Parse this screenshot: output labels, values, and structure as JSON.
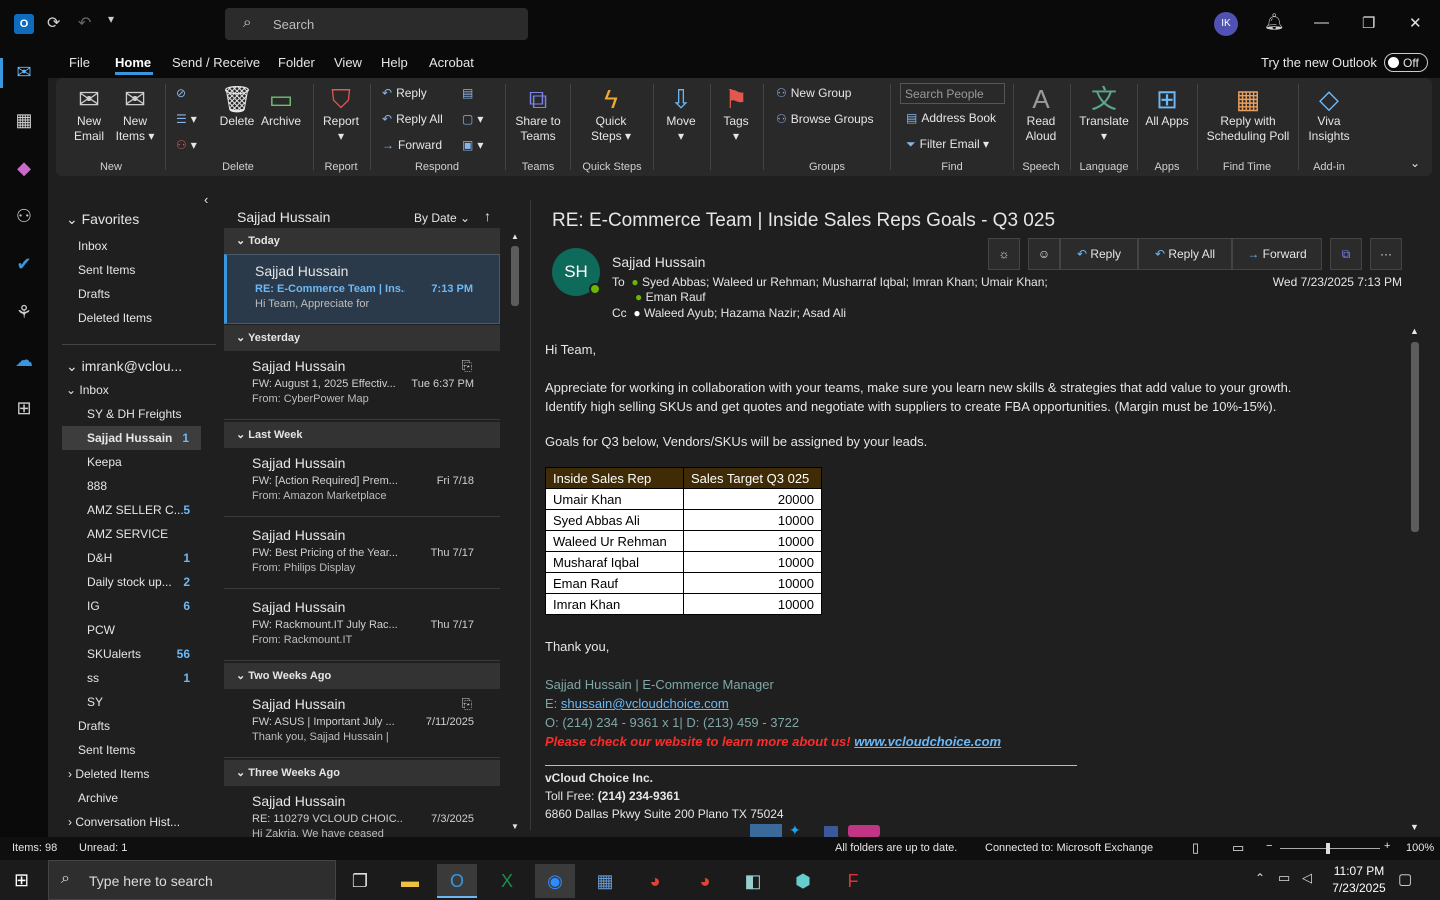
{
  "titlebar": {
    "search_placeholder": "Search",
    "avatar_initials": "IK"
  },
  "menu": {
    "items": [
      "File",
      "Home",
      "Send / Receive",
      "Folder",
      "View",
      "Help",
      "Acrobat"
    ],
    "try_new": "Try the new Outlook",
    "toggle": "Off"
  },
  "ribbon": {
    "new_email": "New Email",
    "new_items": "New Items",
    "delete": "Delete",
    "archive": "Archive",
    "report": "Report",
    "reply": "Reply",
    "reply_all": "Reply All",
    "forward": "Forward",
    "share_teams": "Share to Teams",
    "quick_steps": "Quick Steps",
    "move": "Move",
    "tags": "Tags",
    "new_group": "New Group",
    "browse_groups": "Browse Groups",
    "search_people": "Search People",
    "address_book": "Address Book",
    "filter_email": "Filter Email",
    "read_aloud": "Read Aloud",
    "translate": "Translate",
    "all_apps": "All Apps",
    "reply_poll": "Reply with Scheduling Poll",
    "viva": "Viva Insights",
    "groups": [
      "New",
      "Delete",
      "Report",
      "Respond",
      "Teams",
      "Quick Steps",
      "Groups",
      "Find",
      "Speech",
      "Language",
      "Apps",
      "Find Time",
      "Add-in"
    ]
  },
  "folders": {
    "favorites": "Favorites",
    "fav_items": [
      "Inbox",
      "Sent Items",
      "Drafts",
      "Deleted Items"
    ],
    "account": "imrank@vclou...",
    "inbox": "Inbox",
    "subfolders": [
      {
        "name": "SY & DH Freights",
        "count": ""
      },
      {
        "name": "Sajjad Hussain",
        "count": "1"
      },
      {
        "name": "Keepa",
        "count": ""
      },
      {
        "name": "888",
        "count": ""
      },
      {
        "name": "AMZ SELLER C...",
        "count": "5"
      },
      {
        "name": "AMZ SERVICE",
        "count": ""
      },
      {
        "name": "D&H",
        "count": "1"
      },
      {
        "name": "Daily stock up...",
        "count": "2"
      },
      {
        "name": "IG",
        "count": "6"
      },
      {
        "name": "PCW",
        "count": ""
      },
      {
        "name": "SKUalerts",
        "count": "56"
      },
      {
        "name": "ss",
        "count": "1"
      },
      {
        "name": "SY",
        "count": ""
      }
    ],
    "bottom": [
      "Drafts",
      "Sent Items",
      "Deleted Items",
      "Archive",
      "Conversation Hist..."
    ]
  },
  "list": {
    "header": "Sajjad Hussain",
    "sort": "By Date",
    "groups": [
      "Today",
      "Yesterday",
      "Last Week",
      "Two Weeks Ago",
      "Three Weeks Ago"
    ],
    "messages": [
      {
        "from": "Sajjad Hussain",
        "subject": "RE: E-Commerce Team | Ins...",
        "preview": "Hi Team,  Appreciate for",
        "date": "7:13 PM"
      },
      {
        "from": "Sajjad Hussain",
        "subject": "FW: August 1, 2025 Effectiv...",
        "preview": "From: CyberPower Map",
        "date": "Tue 6:37 PM"
      },
      {
        "from": "Sajjad Hussain",
        "subject": "FW: [Action Required] Prem...",
        "preview": "From: Amazon Marketplace",
        "date": "Fri 7/18"
      },
      {
        "from": "Sajjad Hussain",
        "subject": "FW: Best Pricing of the Year...",
        "preview": "From: Philips Display",
        "date": "Thu 7/17"
      },
      {
        "from": "Sajjad Hussain",
        "subject": "FW: Rackmount.IT July Rac...",
        "preview": "From: Rackmount.IT",
        "date": "Thu 7/17"
      },
      {
        "from": "Sajjad Hussain",
        "subject": "FW: ASUS | Important July ...",
        "preview": "Thank you,  Sajjad Hussain |",
        "date": "7/11/2025"
      },
      {
        "from": "Sajjad Hussain",
        "subject": "RE: 110279 VCLOUD CHOIC...",
        "preview": "Hi Zakria,  We have ceased",
        "date": "7/3/2025"
      }
    ]
  },
  "email": {
    "title": "RE: E-Commerce Team | Inside Sales Reps Goals - Q3 025",
    "initials": "SH",
    "sender": "Sajjad Hussain",
    "to_label": "To",
    "to": "Syed Abbas;  Waleed ur Rehman;  Musharraf Iqbal;  Imran Khan;  Umair Khan;",
    "to2": "Eman Rauf",
    "cc_label": "Cc",
    "cc": "Waleed Ayub;  Hazama Nazir;  Asad Ali",
    "date": "Wed 7/23/2025 7:13 PM",
    "reply": "Reply",
    "reply_all": "Reply All",
    "forward": "Forward",
    "greeting": "Hi Team,",
    "para1": "Appreciate for working in collaboration with your teams, make sure you learn new skills & strategies that add value to your growth.",
    "para2": "Identify high selling SKUs and get quotes and negotiate with suppliers to create FBA opportunities. (Margin must be 10%-15%).",
    "para3": "Goals for Q3 below, Vendors/SKUs will be assigned by your leads.",
    "table_head": [
      "Inside Sales Rep",
      "Sales Target Q3 025"
    ],
    "table_rows": [
      [
        "Umair Khan",
        "20000"
      ],
      [
        "Syed Abbas Ali",
        "10000"
      ],
      [
        "Waleed Ur Rehman",
        "10000"
      ],
      [
        "Musharaf Iqbal",
        "10000"
      ],
      [
        "Eman Rauf",
        "10000"
      ],
      [
        "Imran Khan",
        "10000"
      ]
    ],
    "thanks": "Thank you,",
    "sig_name": "Sajjad Hussain | E-Commerce Manager",
    "sig_email_label": "E: ",
    "sig_email": "shussain@vcloudchoice.com",
    "sig_phone": "O: (214) 234 - 9361 x 1| D: (213) 459 - 3722",
    "sig_promo": "Please check our website to learn more about us! ",
    "sig_web": "www.vcloudchoice.com",
    "company": "vCloud Choice Inc.",
    "tollfree_label": "Toll Free: ",
    "tollfree": "(214) 234-9361",
    "address": "6860 Dallas Pkwy Suite 200 Plano TX 75024"
  },
  "status": {
    "items": "Items: 98",
    "unread": "Unread: 1",
    "sync": "All folders are up to date.",
    "connected": "Connected to: Microsoft Exchange",
    "zoom": "100%"
  },
  "taskbar": {
    "search": "Type here to search",
    "time": "11:07 PM",
    "date": "7/23/2025"
  },
  "colors": {
    "accent": "#3a96dd",
    "unread": "#6cb8f6",
    "table_header": "#3f2c06",
    "promo_red": "#ff2a2a",
    "sig_teal": "#7fa7a7"
  }
}
